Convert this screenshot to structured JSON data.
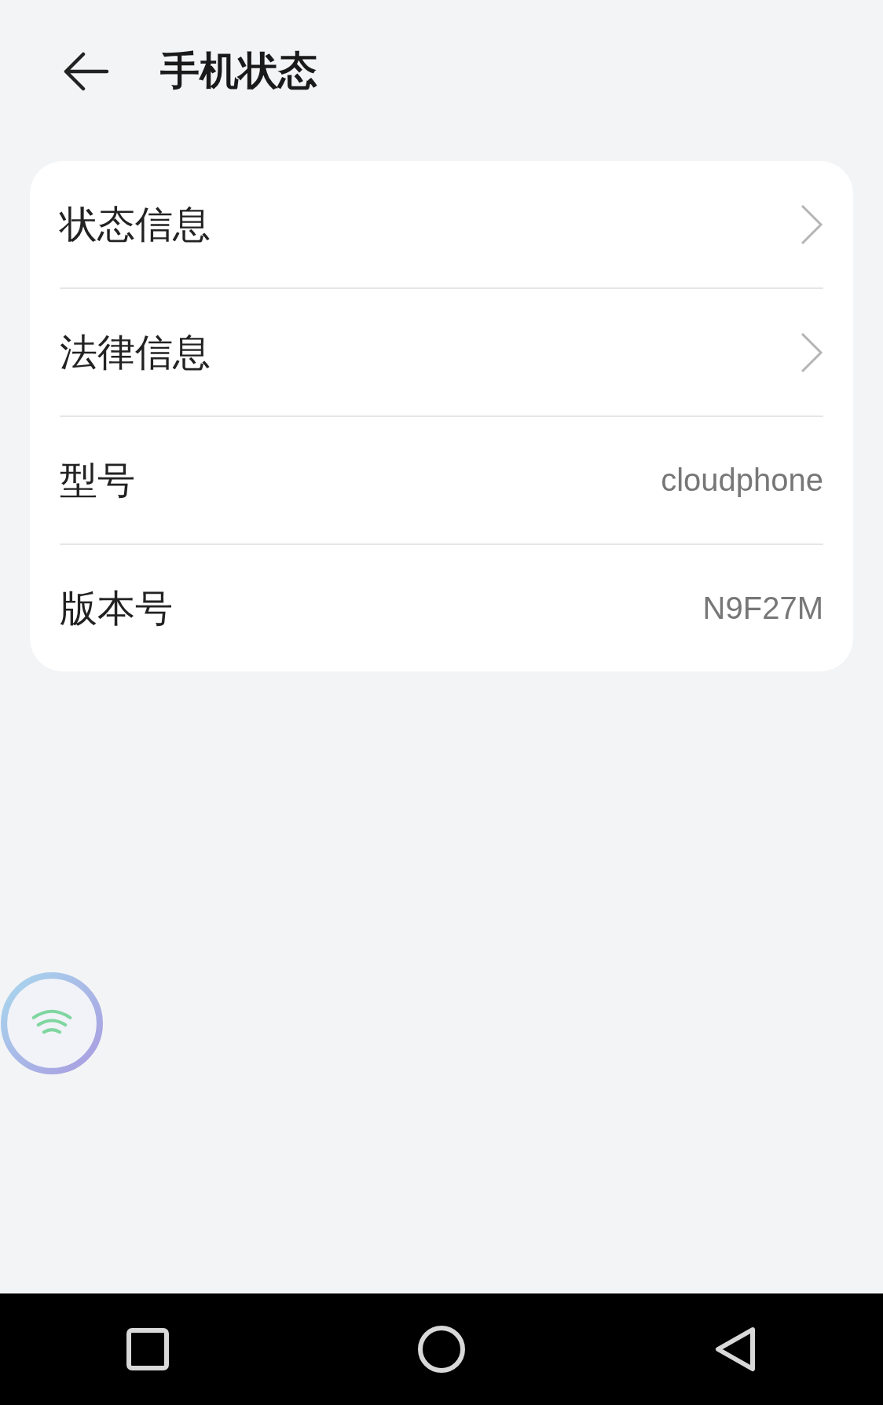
{
  "header": {
    "title": "手机状态"
  },
  "items": [
    {
      "kind": "link",
      "label": "状态信息"
    },
    {
      "kind": "link",
      "label": "法律信息"
    },
    {
      "kind": "value",
      "label": "型号",
      "value": "cloudphone"
    },
    {
      "kind": "value",
      "label": "版本号",
      "value": "N9F27M"
    }
  ]
}
